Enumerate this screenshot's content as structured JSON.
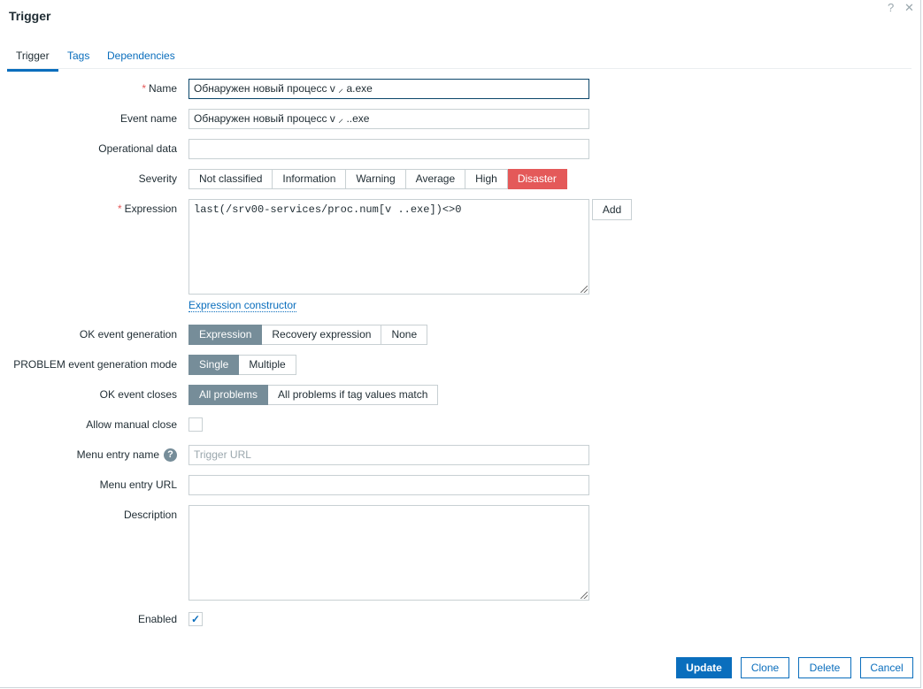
{
  "dialog": {
    "title": "Trigger",
    "help": "?",
    "close": "✕"
  },
  "tabs": [
    "Trigger",
    "Tags",
    "Dependencies"
  ],
  "form": {
    "name": {
      "label": "Name",
      "value": "Обнаружен новый процесс v  ⸝  a.exe"
    },
    "event_name": {
      "label": "Event name",
      "value": "Обнаружен новый процесс v  ⸝ ..exe"
    },
    "operational_data": {
      "label": "Operational data",
      "value": ""
    },
    "severity": {
      "label": "Severity",
      "options": [
        "Not classified",
        "Information",
        "Warning",
        "Average",
        "High",
        "Disaster"
      ],
      "selected": "Disaster"
    },
    "expression": {
      "label": "Expression",
      "value": "last(/srv00-services/proc.num[v      ..exe])<>0",
      "add": "Add",
      "constructor": "Expression constructor"
    },
    "ok_event_generation": {
      "label": "OK event generation",
      "options": [
        "Expression",
        "Recovery expression",
        "None"
      ],
      "selected": "Expression"
    },
    "problem_mode": {
      "label": "PROBLEM event generation mode",
      "options": [
        "Single",
        "Multiple"
      ],
      "selected": "Single"
    },
    "ok_event_closes": {
      "label": "OK event closes",
      "options": [
        "All problems",
        "All problems if tag values match"
      ],
      "selected": "All problems"
    },
    "allow_manual_close": {
      "label": "Allow manual close",
      "checked": false
    },
    "menu_entry_name": {
      "label": "Menu entry name",
      "placeholder": "Trigger URL",
      "help": "?"
    },
    "menu_entry_url": {
      "label": "Menu entry URL",
      "value": ""
    },
    "description": {
      "label": "Description",
      "value": ""
    },
    "enabled": {
      "label": "Enabled",
      "checked": true,
      "mark": "✓"
    }
  },
  "footer": {
    "update": "Update",
    "clone": "Clone",
    "delete": "Delete",
    "cancel": "Cancel"
  }
}
